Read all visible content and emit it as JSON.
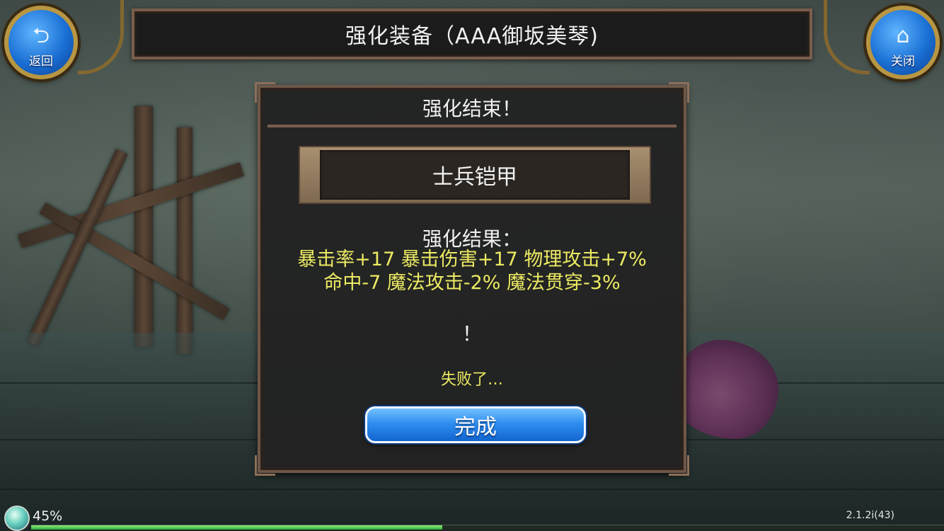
{
  "header": {
    "back_label": "返回",
    "back_icon": "back-arrow-icon",
    "close_label": "关闭",
    "close_icon": "home-icon",
    "title": "强化装备（AAA御坂美琴)"
  },
  "dialog": {
    "title": "强化结束！",
    "item_name": "士兵铠甲",
    "result_label": "强化结果：",
    "result_text": "暴击率+17 暴击伤害+17 物理攻击+7% 命中-7 魔法攻击-2% 魔法贯穿-3%",
    "exclaim": "！",
    "status": "失败了…",
    "done_label": "完成"
  },
  "footer": {
    "progress_label": "45%",
    "progress_value": 0.45,
    "version": "2.1.2i(43)"
  },
  "colors": {
    "highlight_text": "#ecea63",
    "button_blue": "#2f8ef0",
    "frame_brown": "#7a5d4c"
  }
}
